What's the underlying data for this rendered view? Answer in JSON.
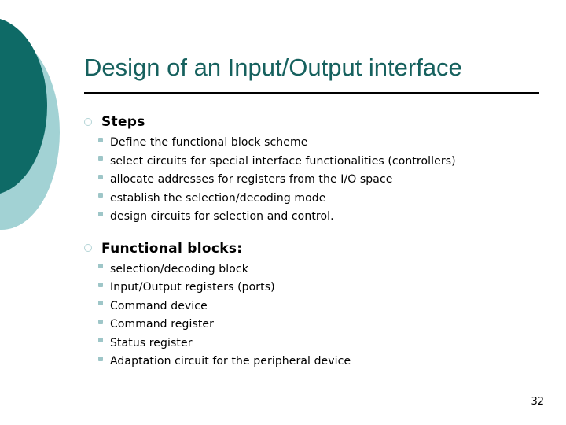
{
  "slide": {
    "title": "Design of an Input/Output interface",
    "page_number": "32",
    "colors": {
      "title": "#16615E",
      "circle_dark": "#0E6A66",
      "circle_light": "#A2D2D4",
      "rule": "#000000",
      "bullet_level1": "#B3D4D6",
      "bullet_level2": "#9EC6C8",
      "body_text": "#000000"
    },
    "sections": [
      {
        "heading": "Steps",
        "bullet_icon": "hollow-circle-bullet-icon",
        "items": [
          "Define the functional block scheme",
          "select circuits for special interface functionalities (controllers)",
          "allocate addresses for registers from the I/O space",
          "establish the selection/decoding mode",
          "design circuits for selection and control."
        ]
      },
      {
        "heading": "Functional blocks:",
        "bullet_icon": "hollow-circle-bullet-icon",
        "items": [
          "selection/decoding block",
          "Input/Output registers (ports)",
          "Command device",
          "Command register",
          "Status register",
          "Adaptation circuit for the peripheral device"
        ]
      }
    ]
  }
}
